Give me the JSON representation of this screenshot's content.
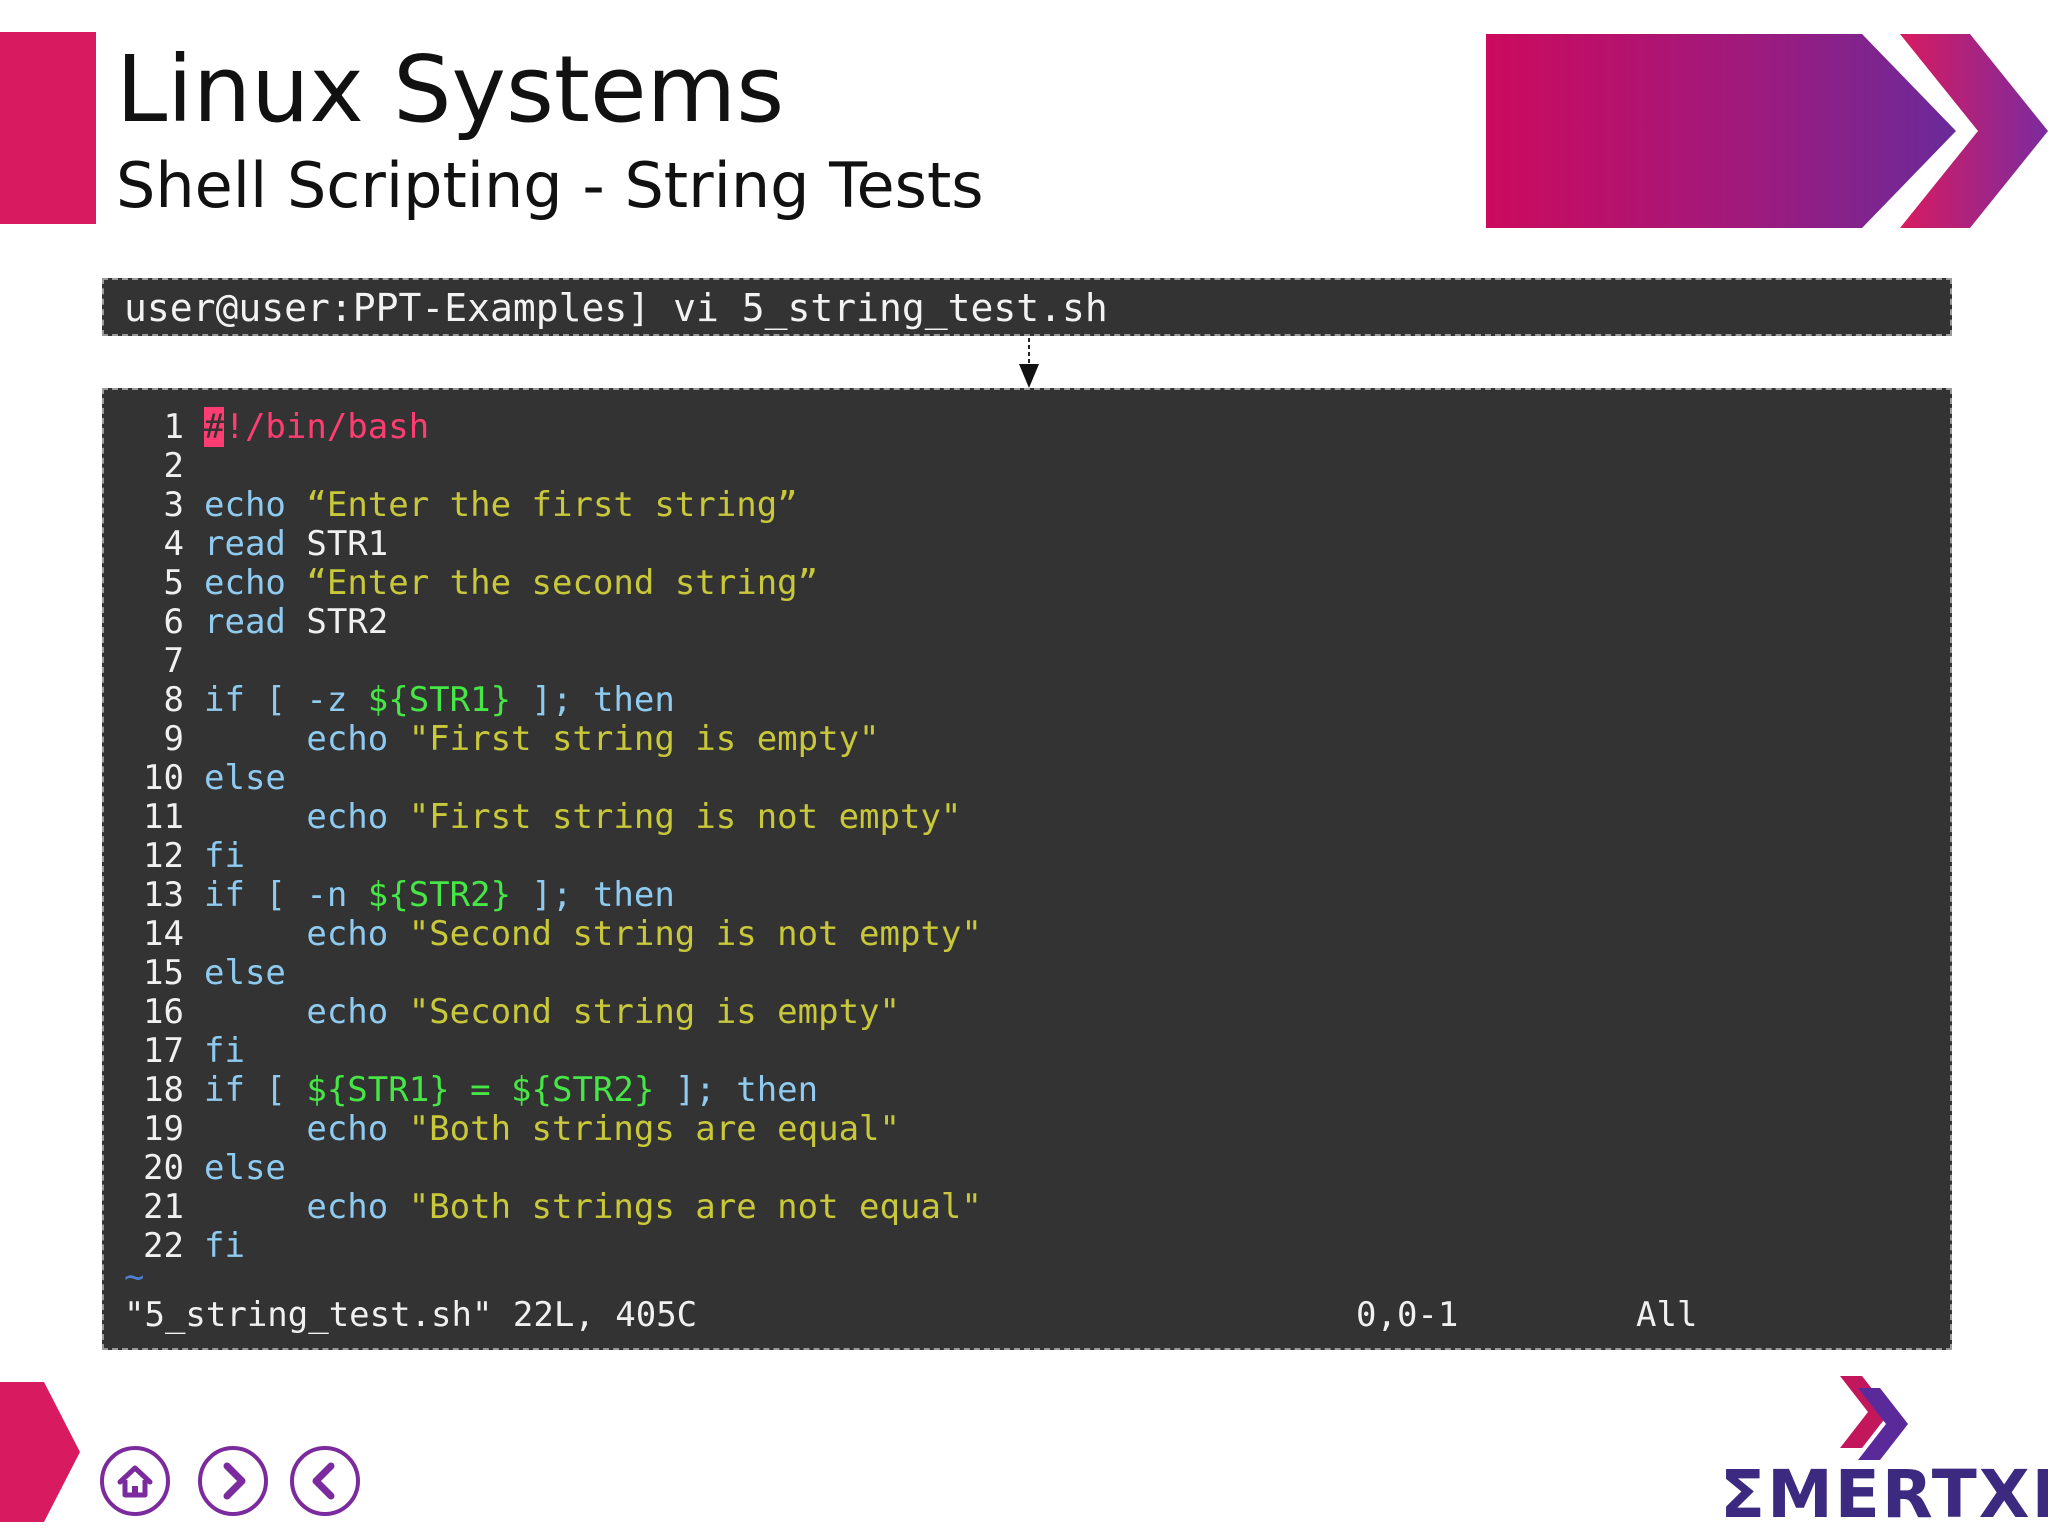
{
  "slide": {
    "title": "Linux Systems",
    "subtitle": "Shell Scripting - String Tests"
  },
  "command": "user@user:PPT-Examples] vi 5_string_test.sh",
  "editor": {
    "lines": [
      {
        "n": "1",
        "tokens": [
          {
            "t": "#",
            "c": "hash"
          },
          {
            "t": "!/bin/bash",
            "c": "shebang"
          }
        ]
      },
      {
        "n": "2",
        "tokens": []
      },
      {
        "n": "3",
        "tokens": [
          {
            "t": "echo",
            "c": "kw"
          },
          {
            "t": " ",
            "c": "plain"
          },
          {
            "t": "“Enter the first string”",
            "c": "str"
          }
        ]
      },
      {
        "n": "4",
        "tokens": [
          {
            "t": "read",
            "c": "kw"
          },
          {
            "t": " STR1",
            "c": "plain"
          }
        ]
      },
      {
        "n": "5",
        "tokens": [
          {
            "t": "echo",
            "c": "kw"
          },
          {
            "t": " ",
            "c": "plain"
          },
          {
            "t": "“Enter the second string”",
            "c": "str"
          }
        ]
      },
      {
        "n": "6",
        "tokens": [
          {
            "t": "read",
            "c": "kw"
          },
          {
            "t": " STR2",
            "c": "plain"
          }
        ]
      },
      {
        "n": "7",
        "tokens": []
      },
      {
        "n": "8",
        "tokens": [
          {
            "t": "if [ -z ",
            "c": "kw"
          },
          {
            "t": "${STR1}",
            "c": "var"
          },
          {
            "t": " ]; then",
            "c": "kw"
          }
        ]
      },
      {
        "n": "9",
        "tokens": [
          {
            "t": "     echo ",
            "c": "kw"
          },
          {
            "t": "\"First string is empty\"",
            "c": "str"
          }
        ]
      },
      {
        "n": "10",
        "tokens": [
          {
            "t": "else",
            "c": "kw"
          }
        ]
      },
      {
        "n": "11",
        "tokens": [
          {
            "t": "     echo ",
            "c": "kw"
          },
          {
            "t": "\"First string is not empty\"",
            "c": "str"
          }
        ]
      },
      {
        "n": "12",
        "tokens": [
          {
            "t": "fi",
            "c": "kw"
          }
        ]
      },
      {
        "n": "13",
        "tokens": [
          {
            "t": "if [ -n ",
            "c": "kw"
          },
          {
            "t": "${STR2}",
            "c": "var"
          },
          {
            "t": " ]; then",
            "c": "kw"
          }
        ]
      },
      {
        "n": "14",
        "tokens": [
          {
            "t": "     echo ",
            "c": "kw"
          },
          {
            "t": "\"Second string is not empty\"",
            "c": "str"
          }
        ]
      },
      {
        "n": "15",
        "tokens": [
          {
            "t": "else",
            "c": "kw"
          }
        ]
      },
      {
        "n": "16",
        "tokens": [
          {
            "t": "     echo ",
            "c": "kw"
          },
          {
            "t": "\"Second string is empty\"",
            "c": "str"
          }
        ]
      },
      {
        "n": "17",
        "tokens": [
          {
            "t": "fi",
            "c": "kw"
          }
        ]
      },
      {
        "n": "18",
        "tokens": [
          {
            "t": "if [ ",
            "c": "kw"
          },
          {
            "t": "${STR1} = ${STR2}",
            "c": "var"
          },
          {
            "t": " ]; then",
            "c": "kw"
          }
        ]
      },
      {
        "n": "19",
        "tokens": [
          {
            "t": "     echo ",
            "c": "kw"
          },
          {
            "t": "\"Both strings are equal\"",
            "c": "str"
          }
        ]
      },
      {
        "n": "20",
        "tokens": [
          {
            "t": "else",
            "c": "kw"
          }
        ]
      },
      {
        "n": "21",
        "tokens": [
          {
            "t": "     echo ",
            "c": "kw"
          },
          {
            "t": "\"Both strings are not equal\"",
            "c": "str"
          }
        ]
      },
      {
        "n": "22",
        "tokens": [
          {
            "t": "fi",
            "c": "kw"
          }
        ]
      }
    ],
    "tilde": "~",
    "status_file": "\"5_string_test.sh\" 22L, 405C",
    "status_position": "0,0-1",
    "status_view": "All"
  },
  "nav": {
    "home_icon": "home-icon",
    "next_icon": "chevron-right-icon",
    "prev_icon": "chevron-left-icon"
  },
  "logo": {
    "text": "ΣMERTXE"
  },
  "colors": {
    "accent": "#d81b60",
    "purple": "#7b2b9e",
    "editor_bg": "#333333"
  }
}
